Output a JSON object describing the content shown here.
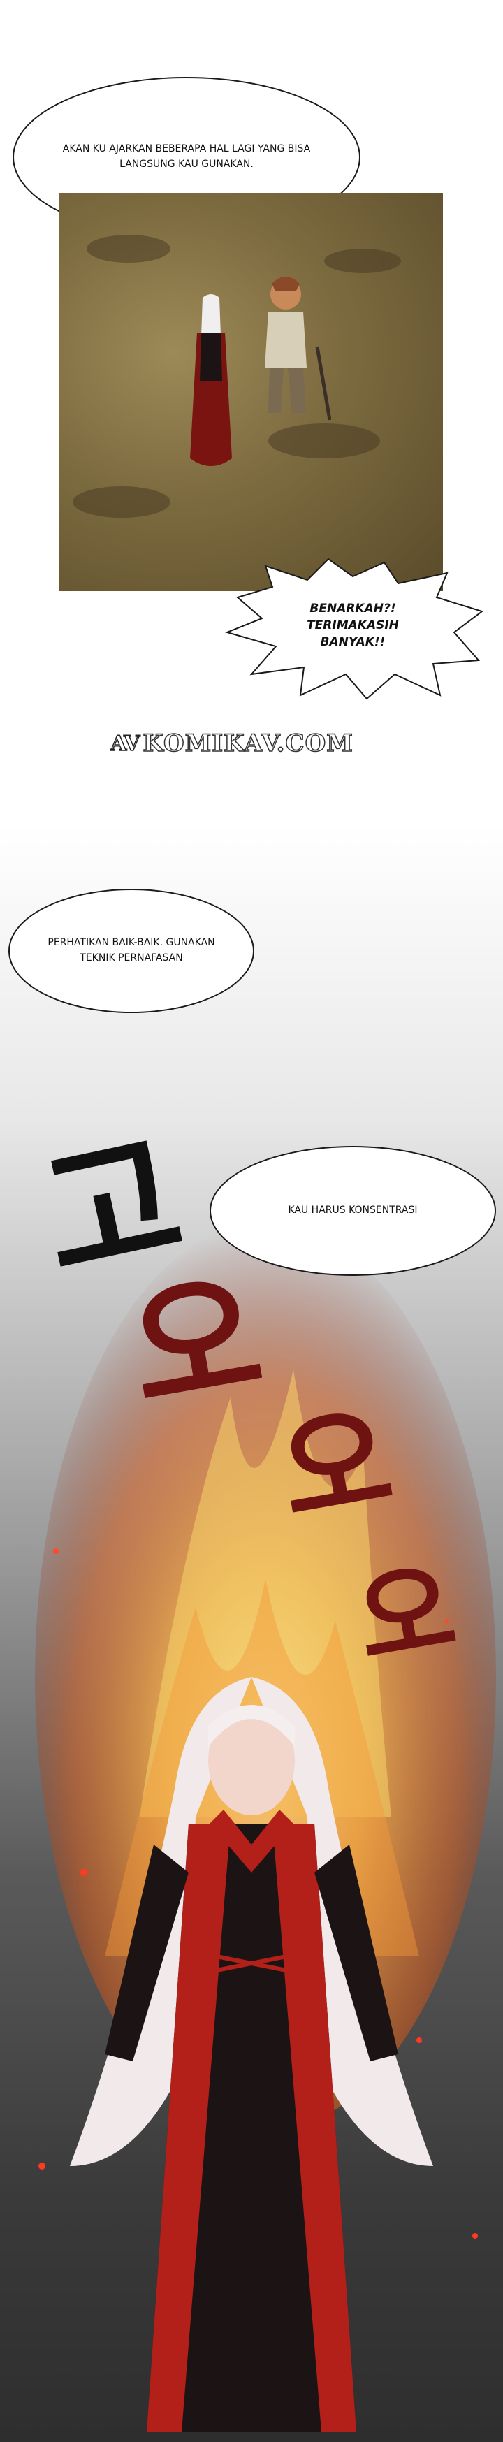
{
  "panels": {
    "top": {
      "bubble_speech": "AKAN KU AJARKAN BEBERAPA HAL LAGI YANG BISA LANGSUNG KAU GUNAKAN.",
      "shout_reply": "BENARKAH?! TERIMAKASIH BANYAK!!"
    },
    "watermark": {
      "mark": "AV",
      "text": "KOMIKAV.COM"
    },
    "fire": {
      "bubble_breathing": "PERHATIKAN BAIK-BAIK. GUNAKAN TEKNIK PERNAFASAN",
      "bubble_focus": "KAU HARUS KONSENTRASI",
      "sfx": [
        "고",
        "오",
        "오",
        "오"
      ]
    }
  },
  "colors": {
    "robe_red": "#b3201a",
    "robe_black": "#1c1414",
    "hair": "#f2eaea",
    "sfx_black": "#111111",
    "sfx_red": "#6e1212"
  }
}
